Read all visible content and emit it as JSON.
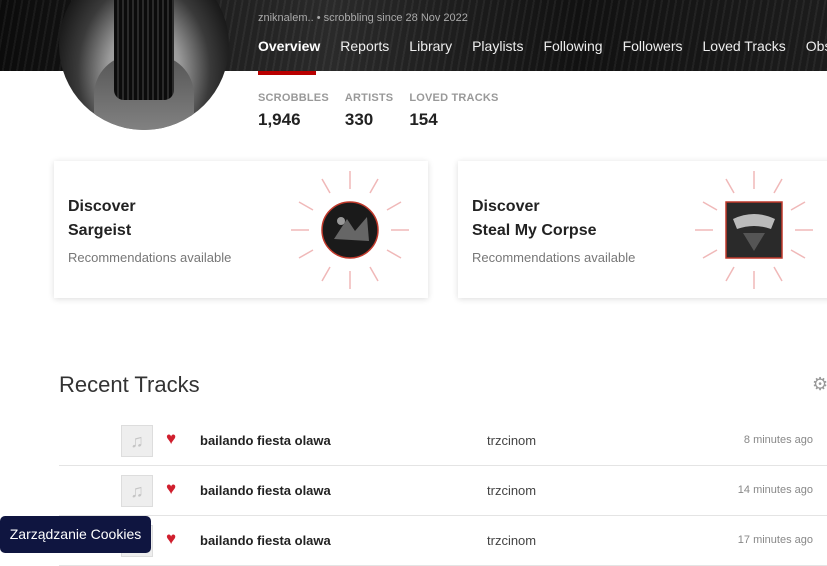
{
  "profile": {
    "meta": "zniknalem.. • scrobbling since 28 Nov 2022"
  },
  "nav": {
    "tabs": [
      {
        "label": "Overview"
      },
      {
        "label": "Reports"
      },
      {
        "label": "Library"
      },
      {
        "label": "Playlists"
      },
      {
        "label": "Following"
      },
      {
        "label": "Followers"
      },
      {
        "label": "Loved Tracks"
      },
      {
        "label": "Obses"
      }
    ],
    "active_tab": "Overview"
  },
  "stats": [
    {
      "label": "SCROBBLES",
      "value": "1,946"
    },
    {
      "label": "ARTISTS",
      "value": "330"
    },
    {
      "label": "LOVED TRACKS",
      "value": "154"
    }
  ],
  "discover": [
    {
      "heading": "Discover",
      "artist": "Sargeist",
      "subtitle": "Recommendations available"
    },
    {
      "heading": "Discover",
      "artist": "Steal My Corpse",
      "subtitle": "Recommendations available"
    }
  ],
  "recent": {
    "title": "Recent Tracks",
    "rows": [
      {
        "track": "bailando fiesta olawa",
        "artist": "trzcinom",
        "time": "8 minutes ago"
      },
      {
        "track": "bailando fiesta olawa",
        "artist": "trzcinom",
        "time": "14 minutes ago"
      },
      {
        "track": "bailando fiesta olawa",
        "artist": "trzcinom",
        "time": "17 minutes ago"
      }
    ]
  },
  "cookies": {
    "label": "Zarządzanie Cookies"
  },
  "colors": {
    "accent": "#b90000",
    "love": "#d01f2e",
    "cookie_bg": "#0f1540"
  }
}
